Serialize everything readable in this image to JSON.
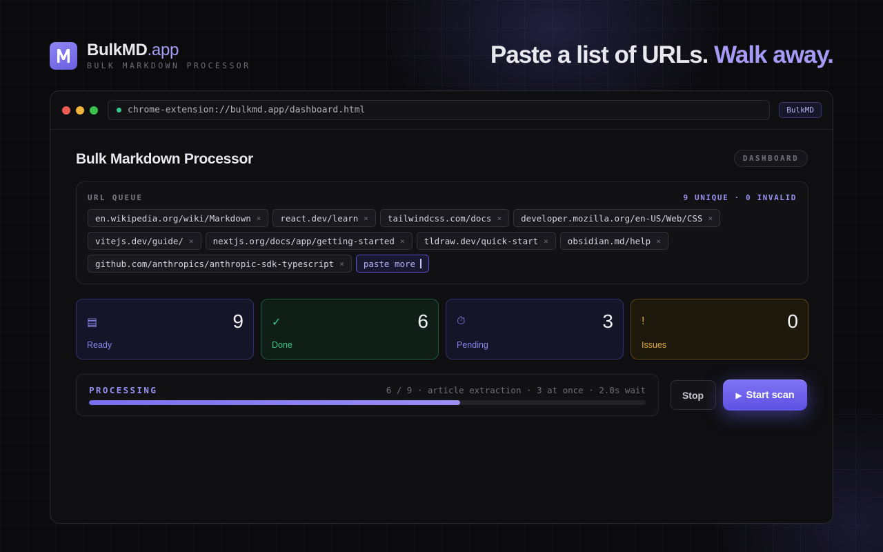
{
  "header": {
    "brand_name": "BulkMD",
    "brand_tld": ".app",
    "brand_sub": "BULK MARKDOWN PROCESSOR",
    "tagline_main": "Paste a list of URLs.",
    "tagline_accent": "Walk away."
  },
  "browser": {
    "url": "chrome-extension://bulkmd.app/dashboard.html",
    "extension_badge": "BulkMD"
  },
  "page": {
    "title": "Bulk Markdown Processor",
    "badge": "DASHBOARD"
  },
  "queue": {
    "label": "URL QUEUE",
    "stats": "9 UNIQUE · 0 INVALID",
    "remove_glyph": "×",
    "urls": [
      "en.wikipedia.org/wiki/Markdown",
      "react.dev/learn",
      "tailwindcss.com/docs",
      "developer.mozilla.org/en-US/Web/CSS",
      "vitejs.dev/guide/",
      "nextjs.org/docs/app/getting-started",
      "tldraw.dev/quick-start",
      "obsidian.md/help",
      "github.com/anthropics/anthropic-sdk-typescript"
    ],
    "input_placeholder": "paste more"
  },
  "stats": [
    {
      "key": "ready",
      "icon": "list-icon",
      "glyph": "▤",
      "value": "9",
      "label": "Ready"
    },
    {
      "key": "done",
      "icon": "check-icon",
      "glyph": "✓",
      "value": "6",
      "label": "Done"
    },
    {
      "key": "pending",
      "icon": "stopwatch-icon",
      "glyph": "⏱",
      "value": "3",
      "label": "Pending"
    },
    {
      "key": "issues",
      "icon": "warning-icon",
      "glyph": "!",
      "value": "0",
      "label": "Issues"
    }
  ],
  "progress": {
    "label": "PROCESSING",
    "meta": "6 / 9 · article extraction · 3 at once · 2.0s wait",
    "done": 6,
    "total": 9
  },
  "actions": {
    "stop_label": "Stop",
    "start_label": "Start scan",
    "start_icon": "▶"
  },
  "colors": {
    "accent": "#8e84ec",
    "success": "#3fc987",
    "warning": "#e3a93a",
    "primary_button": "#6a5fe9"
  }
}
